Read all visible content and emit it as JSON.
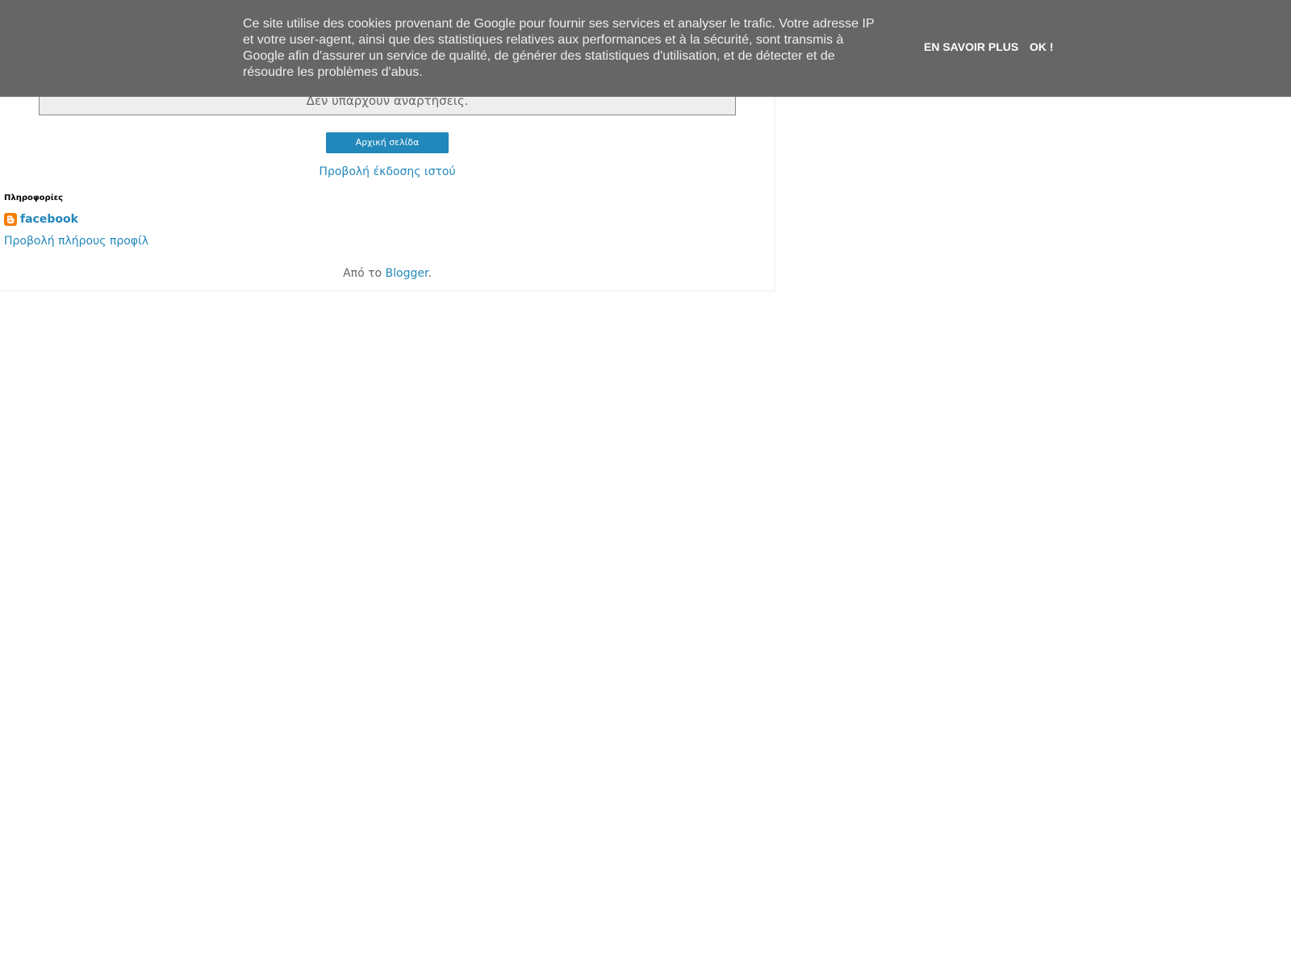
{
  "main": {
    "empty_message": "Δεν υπάρχουν αναρτήσεις.",
    "home_button": "Αρχική σελίδα",
    "web_version_link": "Προβολή έκδοσης ιστού"
  },
  "profile": {
    "title": "Πληροφορίες",
    "name": "facebook",
    "icon": "blogger-icon",
    "full_profile_link": "Προβολή πλήρους προφίλ"
  },
  "footer": {
    "powered_by_prefix": "Από το ",
    "blogger_link": "Blogger",
    "suffix": "."
  },
  "cookie_banner": {
    "text": "Ce site utilise des cookies provenant de Google pour fournir ses services et analyser le trafic. Votre adresse IP et votre user-agent, ainsi que des statistiques relatives aux performances et à la sécurité, sont transmis à Google afin d'assurer un service de qualité, de générer des statistiques d'utilisation, et de détecter et de résoudre les problèmes d'abus.",
    "learn_more": "En savoir plus",
    "ok": "OK !",
    "background_color": "#666666"
  },
  "colors": {
    "link": "#2288bb",
    "button": "#2288bb",
    "blogger_orange": "#f57d00"
  }
}
